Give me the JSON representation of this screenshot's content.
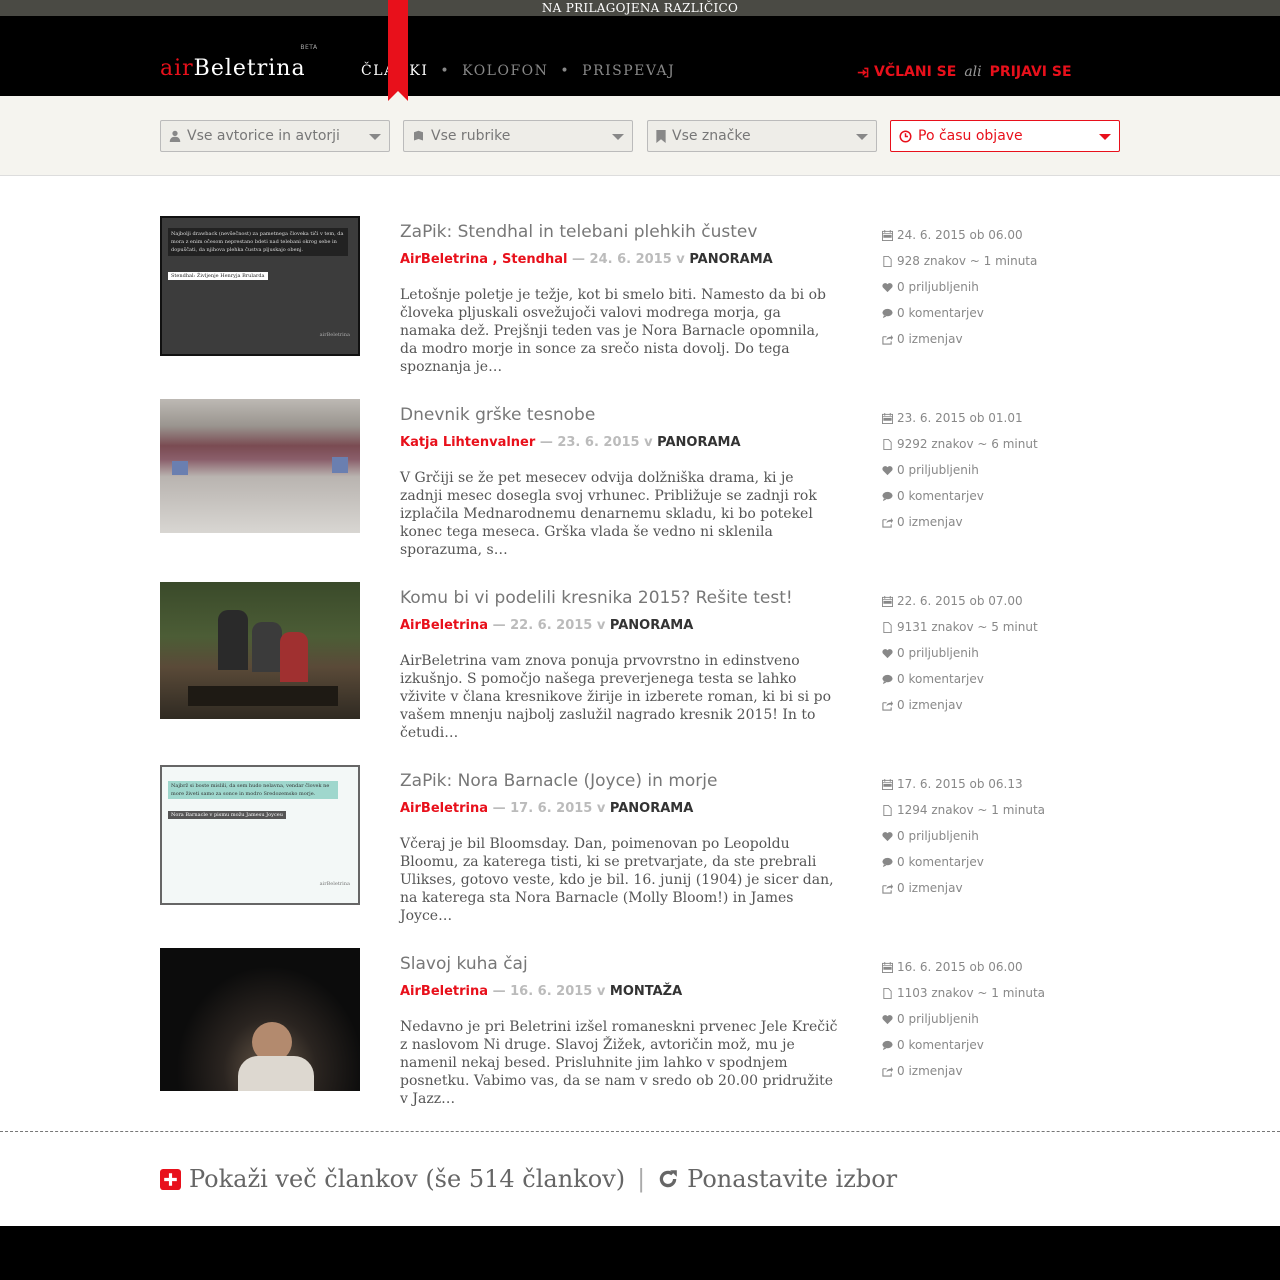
{
  "topbar": {
    "text": "NA PRILAGOJENA RAZLIČICO"
  },
  "header": {
    "logo_air": "air",
    "logo_main": "Beletrina",
    "logo_badge": "BETA",
    "nav": [
      "ČLANKI",
      "KOLOFON",
      "PRISPEVAJ"
    ],
    "signup": "VČLANI SE",
    "or": "ali",
    "login": "PRIJAVI SE"
  },
  "filters": {
    "authors": "Vse avtorice in avtorji",
    "sections": "Vse rubrike",
    "tags": "Vse značke",
    "sort": "Po času objave"
  },
  "articles": [
    {
      "title": "ZaPik: Stendhal in telebani plehkih čustev",
      "authors": "AirBeletrina , Stendhal",
      "date": "— 24. 6. 2015 v",
      "category": "PANORAMA",
      "excerpt": "Letošnje poletje je težje, kot bi smelo biti. Namesto da bi ob človeka pljuskali osvežujoči valovi modrega morja, ga namaka dež. Prejšnji teden vas je Nora Barnacle opomnila, da modro morje in sonce za srečo nista dovolj. Do tega spoznanja je…",
      "published": "24. 6. 2015 ob 06.00",
      "length": "928 znakov ~ 1 minuta",
      "likes": "0 priljubljenih",
      "comments": "0 komentarjev",
      "edits": "0 izmenjav",
      "thumb": {
        "quote": "Najbolji drawback (nevšečnost) za pametnega človeka tiči v tem, da mora z enim očesom neprestano bdeti nad telebani okrog sebe in dopuščati, da njihova plehka čustva pljuskajo obenj.",
        "caption": "Stendhal: Življenje Henryja Brularda",
        "mark": "airBeletrina"
      }
    },
    {
      "title": "Dnevnik grške tesnobe",
      "authors": "Katja Lihtenvalner",
      "date": "— 23. 6. 2015 v",
      "category": "PANORAMA",
      "excerpt": "V Grčiji se že pet mesecev odvija dolžniška drama, ki je zadnji mesec dosegla svoj vrhunec. Približuje se zadnji rok izplačila Mednarodnemu denarnemu skladu, ki bo potekel konec tega meseca. Grška vlada še vedno ni sklenila sporazuma, s…",
      "published": "23. 6. 2015 ob 01.01",
      "length": "9292 znakov ~ 6 minut",
      "likes": "0 priljubljenih",
      "comments": "0 komentarjev",
      "edits": "0 izmenjav"
    },
    {
      "title": "Komu bi vi podelili kresnika 2015? Rešite test!",
      "authors": "AirBeletrina",
      "date": "— 22. 6. 2015 v",
      "category": "PANORAMA",
      "excerpt": "AirBeletrina vam znova ponuja prvovrstno in edinstveno izkušnjo. S pomočjo našega preverjenega testa se lahko vživite v člana kresnikove žirije in izberete roman, ki bi si po vašem mnenju najbolj zaslužil nagrado kresnik 2015! In to četudi…",
      "published": "22. 6. 2015 ob 07.00",
      "length": "9131 znakov ~ 5 minut",
      "likes": "0 priljubljenih",
      "comments": "0 komentarjev",
      "edits": "0 izmenjav"
    },
    {
      "title": "ZaPik: Nora Barnacle (Joyce) in morje",
      "authors": "AirBeletrina",
      "date": "— 17. 6. 2015 v",
      "category": "PANORAMA",
      "excerpt": "Včeraj je bil Bloomsday. Dan, poimenovan po Leopoldu Bloomu, za katerega tisti, ki se pretvarjate, da ste prebrali Ulikses, gotovo veste, kdo je bil. 16. junij (1904) je sicer dan, na katerega sta Nora Barnacle (Molly Bloom!) in James Joyce…",
      "published": "17. 6. 2015 ob 06.13",
      "length": "1294 znakov ~ 1 minuta",
      "likes": "0 priljubljenih",
      "comments": "0 komentarjev",
      "edits": "0 izmenjav",
      "thumb": {
        "quote": "Najbrž si boste mislili, da sem hudo nelavna, vendar človek ne more živeti samo za sonce in modro Sredozemsko morje.",
        "caption": "Nora Barnacle v pismu možu Jamesu Joyceu",
        "mark": "airBeletrina"
      }
    },
    {
      "title": "Slavoj kuha čaj",
      "authors": "AirBeletrina",
      "date": "— 16. 6. 2015 v",
      "category": "MONTAŽA",
      "excerpt": "Nedavno je pri Beletrini izšel romaneskni prvenec Jele Krečič z naslovom Ni druge. Slavoj Žižek, avtoričin mož, mu je namenil nekaj besed. Prisluhnite jim lahko v spodnjem posnetku. Vabimo vas, da se nam v sredo ob 20.00 pridružite v Jazz…",
      "published": "16. 6. 2015 ob 06.00",
      "length": "1103 znakov ~ 1 minuta",
      "likes": "0 priljubljenih",
      "comments": "0 komentarjev",
      "edits": "0 izmenjav"
    }
  ],
  "footer": {
    "more": "Pokaži več člankov (še 514 člankov)",
    "sep": "|",
    "reset": "Ponastavite izbor"
  },
  "icons": {
    "login": "sign-in-icon",
    "user": "user-icon",
    "book": "book-icon",
    "tag": "bookmark-icon",
    "clock": "clock-icon",
    "calendar": "calendar-icon",
    "file": "file-icon",
    "heart": "heart-icon",
    "comment": "comment-icon",
    "share": "share-icon",
    "plus": "plus-square-icon",
    "refresh": "refresh-icon"
  },
  "colors": {
    "accent": "#e8101b",
    "header": "#000000",
    "filterbar": "#f5f4ef"
  }
}
